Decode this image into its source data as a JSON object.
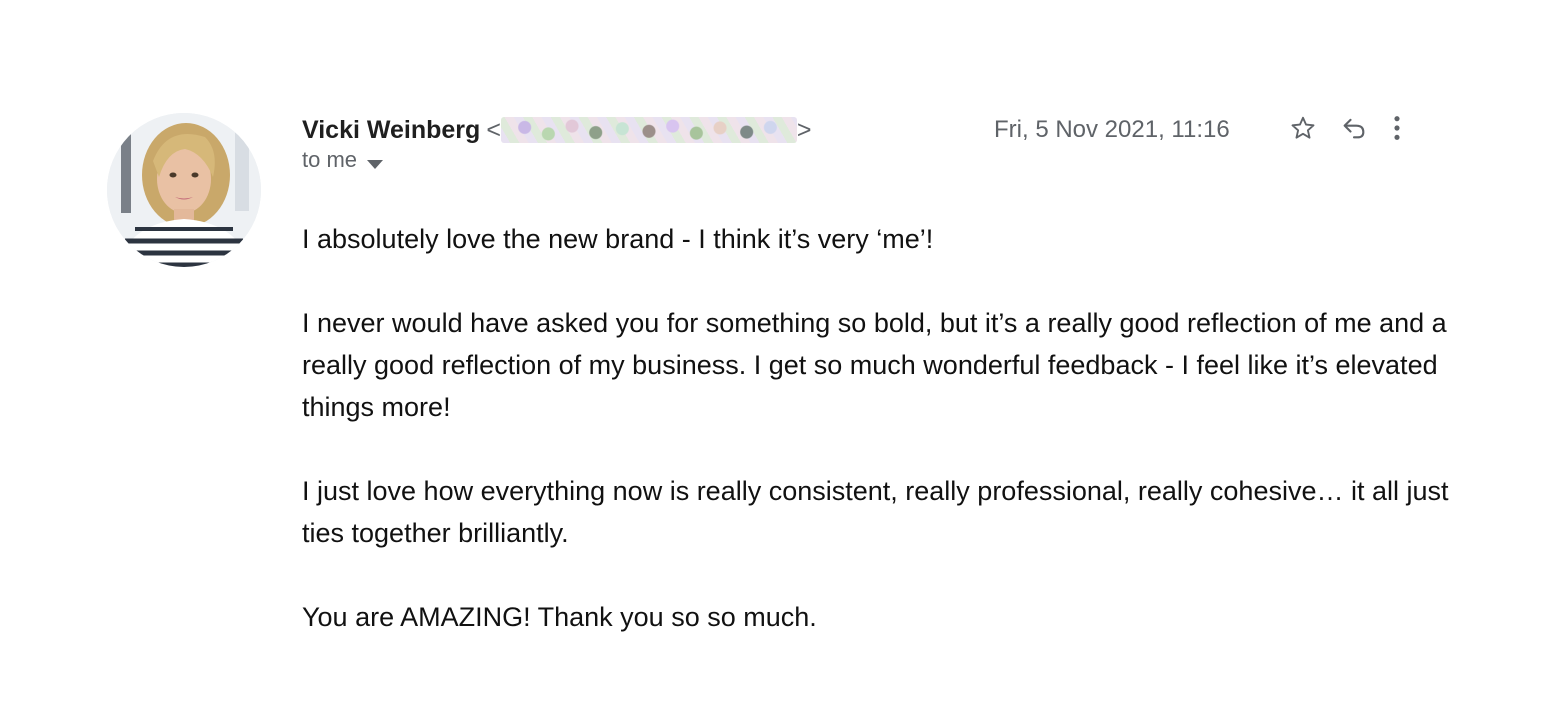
{
  "sender": {
    "name": "Vicki Weinberg",
    "email_open": "<",
    "email_close": ">",
    "email_redacted": true
  },
  "recipient": {
    "label": "to me"
  },
  "date": "Fri, 5 Nov 2021, 11:16",
  "icons": {
    "star": "star-icon",
    "reply": "reply-icon",
    "more": "more-vertical-icon",
    "caret": "chevron-down-icon"
  },
  "body": {
    "paragraphs": [
      "I absolutely love the new brand - I think it’s very ‘me’!",
      "I never would have asked you for something so bold, but it’s a really good reflection of me and a really good reflection of my business. I get so much wonderful feedback - I feel like it’s elevated things more!",
      "I just love how everything now is really consistent, really professional, really cohesive… it all just ties together brilliantly.",
      "You are AMAZING! Thank you so so much."
    ]
  },
  "colors": {
    "secondary_text": "#5f6368",
    "body_text": "#111111"
  }
}
